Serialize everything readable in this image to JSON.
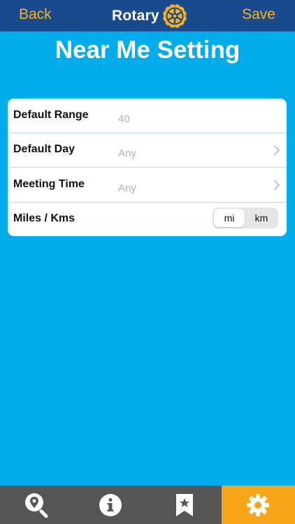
{
  "navbar": {
    "back_label": "Back",
    "save_label": "Save",
    "logo_text": "Rotary",
    "logo_icon": "rotary-wheel-icon",
    "accent_color": "#f7b21c",
    "background_color": "#1a4a8e"
  },
  "page": {
    "title": "Near Me Setting",
    "background_color": "#00adea"
  },
  "settings": {
    "default_range": {
      "label": "Default Range",
      "value": "40"
    },
    "default_day": {
      "label": "Default Day",
      "value": "Any"
    },
    "meeting_time": {
      "label": "Meeting Time",
      "value": "Any"
    },
    "units": {
      "label": "Miles / Kms",
      "options": [
        "mi",
        "km"
      ],
      "selected": "mi"
    }
  },
  "tabbar": {
    "tabs": [
      {
        "icon": "search-location-icon",
        "active": false
      },
      {
        "icon": "info-icon",
        "active": false
      },
      {
        "icon": "bookmark-icon",
        "active": false
      },
      {
        "icon": "gear-icon",
        "active": true
      }
    ],
    "active_color": "#f9a51a",
    "background_color": "#555555"
  }
}
